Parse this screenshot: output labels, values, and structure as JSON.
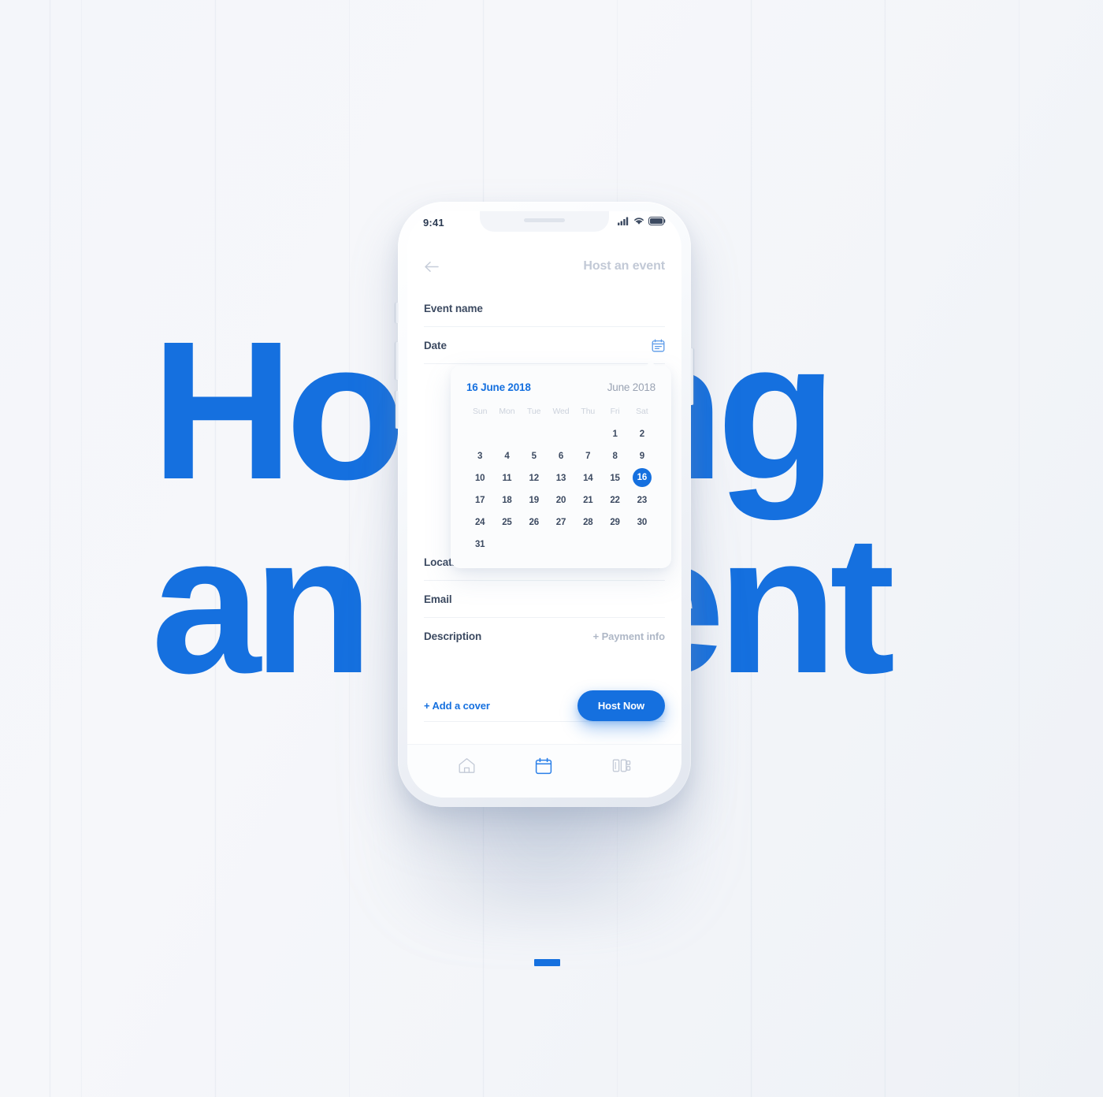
{
  "backdrop": {
    "headline_line1": "Hosting",
    "headline_line2": "an event",
    "accent_color": "#1570df",
    "background_color": "#f4f6fa",
    "marker_label": "scroll-marker"
  },
  "statusbar": {
    "time": "9:41",
    "icons": [
      "cellular-signal-icon",
      "wifi-icon",
      "battery-icon"
    ]
  },
  "header": {
    "back_icon": "back-arrow-icon",
    "title": "Host an event"
  },
  "form": {
    "fields": [
      {
        "label": "Event name",
        "icon": null,
        "value": ""
      },
      {
        "label": "Date",
        "icon": "calendar-icon",
        "value": ""
      },
      {
        "label": "Location",
        "icon": "map-pin-icon",
        "value": ""
      },
      {
        "label": "Email",
        "icon": null,
        "value": ""
      },
      {
        "label": "Description",
        "icon": null,
        "value": "",
        "action": "+ Payment info"
      }
    ],
    "payment_action": "+ Payment info"
  },
  "calendar": {
    "selected_label": "16 June 2018",
    "month_label": "June 2018",
    "selected_day": 16,
    "day_headers": [
      "Sun",
      "Mon",
      "Tue",
      "Wed",
      "Thu",
      "Fri",
      "Sat"
    ],
    "leading_blanks": 5,
    "days": [
      1,
      2,
      3,
      4,
      5,
      6,
      7,
      8,
      9,
      10,
      11,
      12,
      13,
      14,
      15,
      16,
      17,
      18,
      19,
      20,
      21,
      22,
      23,
      24,
      25,
      26,
      27,
      28,
      29,
      30,
      31
    ],
    "accent_color": "#1570df"
  },
  "actions": {
    "add_cover_label": "+ Add a cover",
    "host_now_label": "Host Now"
  },
  "tabbar": {
    "items": [
      {
        "name": "home-icon",
        "active": false
      },
      {
        "name": "calendar-icon",
        "active": true
      },
      {
        "name": "ticket-icon",
        "active": false
      }
    ]
  }
}
